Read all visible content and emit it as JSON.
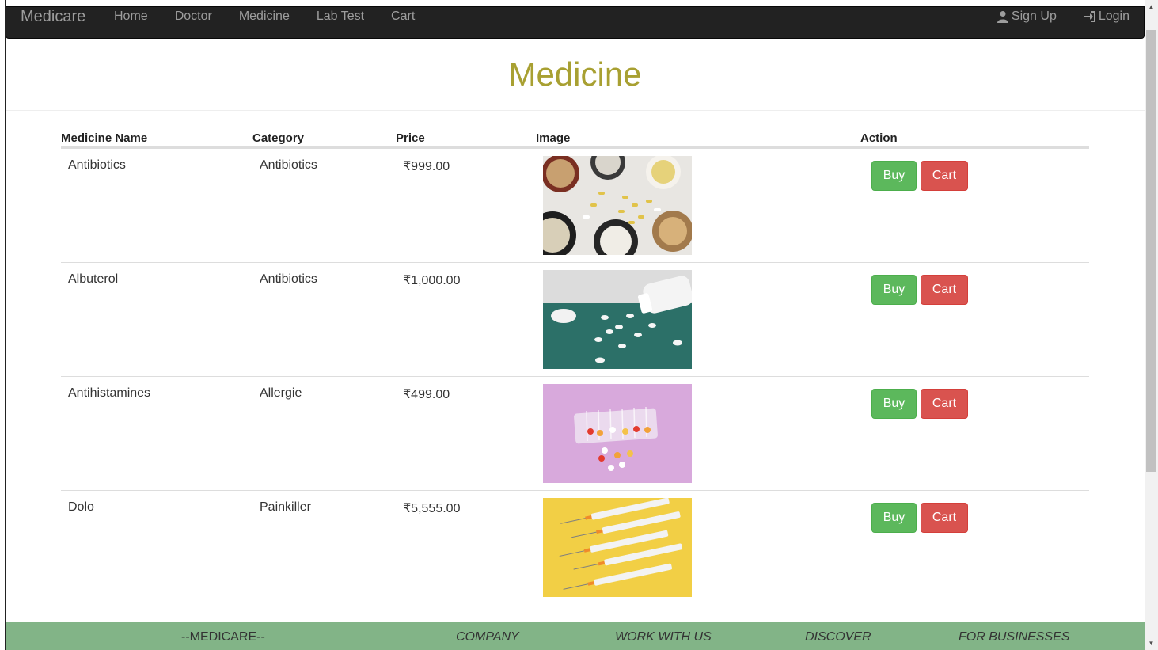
{
  "navbar": {
    "brand": "Medicare",
    "links": [
      "Home",
      "Doctor",
      "Medicine",
      "Lab Test",
      "Cart"
    ],
    "signup": "Sign Up",
    "login": "Login"
  },
  "page": {
    "title": "Medicine"
  },
  "table": {
    "headers": [
      "Medicine Name",
      "Category",
      "Price",
      "Image",
      "Action"
    ],
    "rows": [
      {
        "name": "Antibiotics",
        "category": "Antibiotics",
        "price": "₹999.00",
        "image": "pill-bowls-image",
        "buy": "Buy",
        "cart": "Cart"
      },
      {
        "name": "Albuterol",
        "category": "Antibiotics",
        "price": "₹1,000.00",
        "image": "pill-bottle-image",
        "buy": "Buy",
        "cart": "Cart"
      },
      {
        "name": "Antihistamines",
        "category": "Allergie",
        "price": "₹499.00",
        "image": "pill-organizer-image",
        "buy": "Buy",
        "cart": "Cart"
      },
      {
        "name": "Dolo",
        "category": "Painkiller",
        "price": "₹5,555.00",
        "image": "syringes-image",
        "buy": "Buy",
        "cart": "Cart"
      }
    ]
  },
  "footer": {
    "items": [
      "--MEDICARE--",
      "COMPANY",
      "WORK WITH US",
      "DISCOVER",
      "FOR BUSINESSES"
    ]
  },
  "colors": {
    "navbar_bg": "#222222",
    "title": "#a8a032",
    "buy": "#5cb85c",
    "cart": "#d9534f",
    "footer_bg": "#82b487"
  },
  "icons": {
    "signup": "user-icon",
    "login": "login-icon"
  }
}
